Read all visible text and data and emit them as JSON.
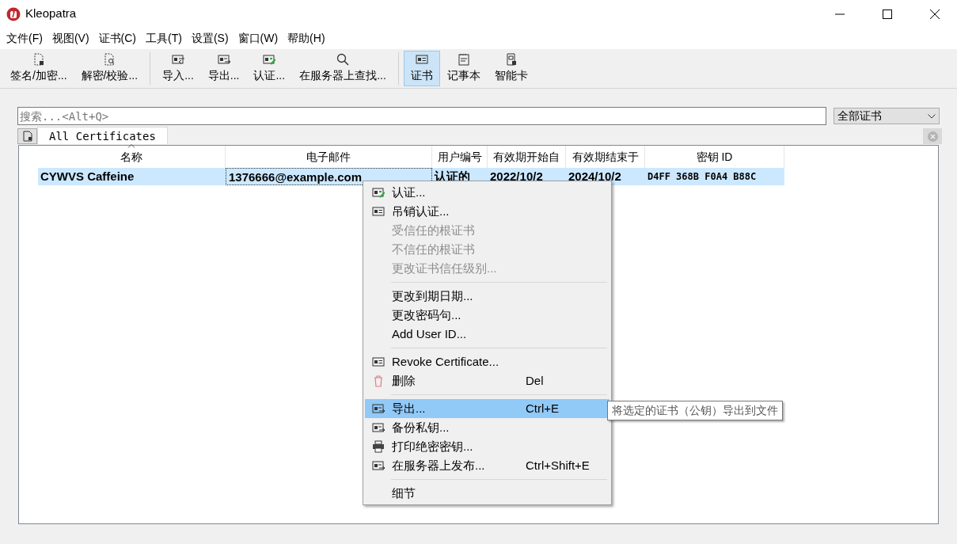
{
  "window": {
    "title": "Kleopatra"
  },
  "menu_bar": [
    "文件(F)",
    "视图(V)",
    "证书(C)",
    "工具(T)",
    "设置(S)",
    "窗口(W)",
    "帮助(H)"
  ],
  "toolbar": [
    {
      "kind": "button",
      "label": "签名/加密...",
      "selected": false
    },
    {
      "kind": "button",
      "label": "解密/校验...",
      "selected": false
    },
    {
      "kind": "separator"
    },
    {
      "kind": "button",
      "label": "导入...",
      "selected": false
    },
    {
      "kind": "button",
      "label": "导出...",
      "selected": false
    },
    {
      "kind": "button",
      "label": "认证...",
      "selected": false
    },
    {
      "kind": "button",
      "label": "在服务器上查找...",
      "selected": false
    },
    {
      "kind": "separator"
    },
    {
      "kind": "button",
      "label": "证书",
      "selected": true
    },
    {
      "kind": "button",
      "label": "记事本",
      "selected": false
    },
    {
      "kind": "button",
      "label": "智能卡",
      "selected": false
    }
  ],
  "search": {
    "placeholder": "搜索...<Alt+Q>"
  },
  "filter": {
    "value": "全部证书"
  },
  "tabs": [
    {
      "label": "All Certificates",
      "selected": true
    }
  ],
  "table": {
    "columns": [
      "名称",
      "电子邮件",
      "用户编号",
      "有效期开始自",
      "有效期结束于",
      "密钥 ID"
    ],
    "rows": [
      {
        "selected": true,
        "cells": [
          "CYWVS Caffeine",
          "1376666@example.com",
          "认证的",
          "2022/10/2",
          "2024/10/2",
          "D4FF 368B F0A4 B88C"
        ]
      }
    ]
  },
  "context_menu": [
    {
      "kind": "item",
      "label": "认证...",
      "disabled": false,
      "selected": false
    },
    {
      "kind": "item",
      "label": "吊销认证...",
      "disabled": false,
      "selected": false
    },
    {
      "kind": "item",
      "label": "受信任的根证书",
      "disabled": true,
      "selected": false
    },
    {
      "kind": "item",
      "label": "不信任的根证书",
      "disabled": true,
      "selected": false
    },
    {
      "kind": "item",
      "label": "更改证书信任级别...",
      "disabled": true,
      "selected": false
    },
    {
      "kind": "separator"
    },
    {
      "kind": "item",
      "label": "更改到期日期...",
      "disabled": false,
      "selected": false
    },
    {
      "kind": "item",
      "label": "更改密码句...",
      "disabled": false,
      "selected": false
    },
    {
      "kind": "item",
      "label": "Add User ID...",
      "disabled": false,
      "selected": false
    },
    {
      "kind": "separator"
    },
    {
      "kind": "item",
      "label": "Revoke Certificate...",
      "disabled": false,
      "selected": false
    },
    {
      "kind": "item",
      "label": "删除",
      "shortcut": "Del",
      "disabled": false,
      "selected": false
    },
    {
      "kind": "separator"
    },
    {
      "kind": "item",
      "label": "导出...",
      "shortcut": "Ctrl+E",
      "disabled": false,
      "selected": true
    },
    {
      "kind": "item",
      "label": "备份私钥...",
      "disabled": false,
      "selected": false
    },
    {
      "kind": "item",
      "label": "打印绝密密钥...",
      "disabled": false,
      "selected": false
    },
    {
      "kind": "item",
      "label": "在服务器上发布...",
      "shortcut": "Ctrl+Shift+E",
      "disabled": false,
      "selected": false
    },
    {
      "kind": "separator"
    },
    {
      "kind": "item",
      "label": "细节",
      "disabled": false,
      "selected": false
    }
  ],
  "tooltip": "将选定的证书（公钥）导出到文件"
}
